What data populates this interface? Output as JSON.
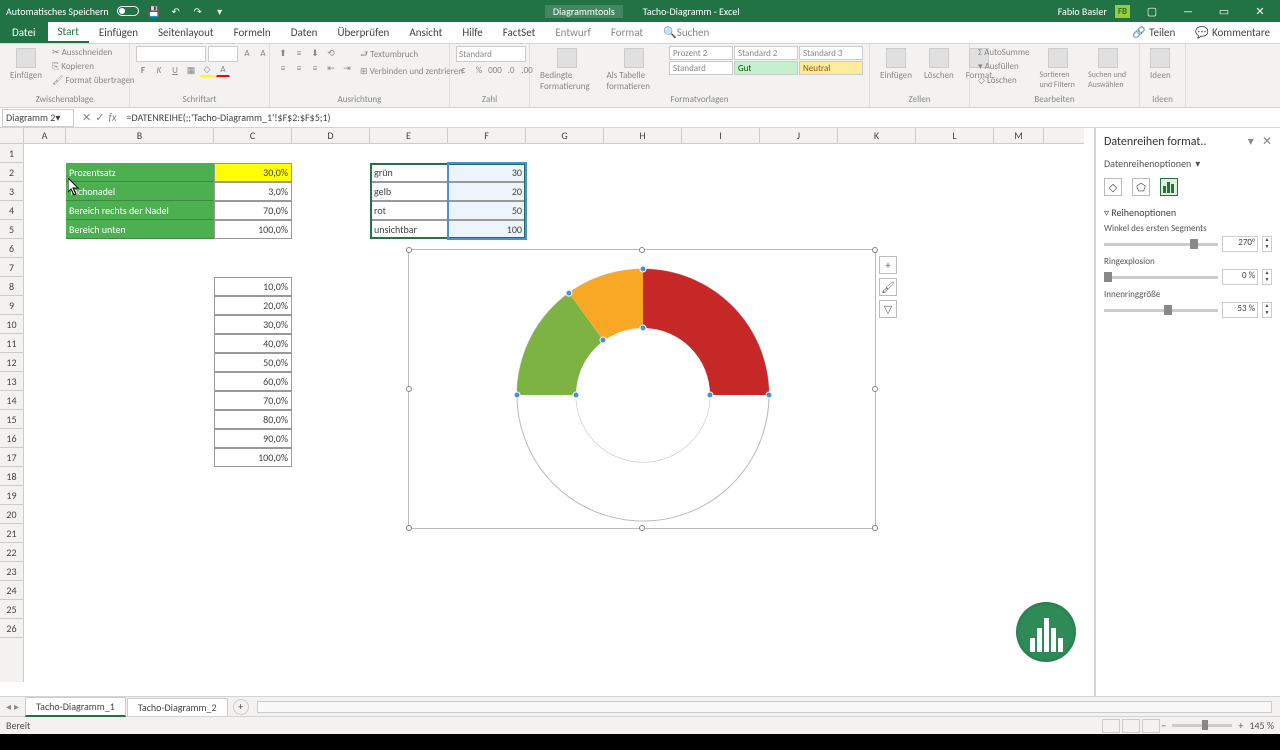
{
  "titlebar": {
    "autosave": "Automatisches Speichern",
    "tools": "Diagrammtools",
    "docname": "Tacho-Diagramm - Excel",
    "username": "Fabio Basler",
    "userinitials": "FB"
  },
  "tabs": {
    "file": "Datei",
    "start": "Start",
    "insert": "Einfügen",
    "layout": "Seitenlayout",
    "formulas": "Formeln",
    "data": "Daten",
    "review": "Überprüfen",
    "view": "Ansicht",
    "help": "Hilfe",
    "factset": "FactSet",
    "design": "Entwurf",
    "format": "Format",
    "search": "Suchen",
    "share": "Teilen",
    "comments": "Kommentare"
  },
  "ribbon": {
    "clipboard": {
      "label": "Zwischenablage",
      "paste": "Einfügen",
      "cut": "Ausschneiden",
      "copy": "Kopieren",
      "formatpainter": "Format übertragen"
    },
    "font": {
      "label": "Schriftart"
    },
    "align": {
      "label": "Ausrichtung",
      "wrap": "Textumbruch",
      "merge": "Verbinden und zentrieren"
    },
    "number": {
      "label": "Zahl",
      "std": "Standard"
    },
    "styles": {
      "label": "Formatvorlagen",
      "cond": "Bedingte Formatierung",
      "table": "Als Tabelle formatieren",
      "p1": "Prozent 2",
      "s2": "Standard 2",
      "s3": "Standard 3",
      "std": "Standard",
      "gut": "Gut",
      "neutral": "Neutral"
    },
    "cells": {
      "label": "Zellen",
      "ins": "Einfügen",
      "del": "Löschen",
      "fmt": "Format"
    },
    "editing": {
      "label": "Bearbeiten",
      "sum": "AutoSumme",
      "fill": "Ausfüllen",
      "clear": "Löschen",
      "sort": "Sortieren und Filtern",
      "find": "Suchen und Auswählen"
    },
    "ideas": {
      "label": "Ideen",
      "btn": "Ideen"
    }
  },
  "formula": {
    "namebox": "Diagramm 2",
    "formula": "=DATENREIHE(;;'Tacho-Diagramm_1'!$F$2:$F$5;1)"
  },
  "columns": [
    "A",
    "B",
    "C",
    "D",
    "E",
    "F",
    "G",
    "H",
    "I",
    "J",
    "K",
    "L",
    "M"
  ],
  "table1": {
    "r1": {
      "b": "Prozentsatz",
      "c": "30,0%"
    },
    "r2": {
      "b": "Tachonadel",
      "c": "3,0%"
    },
    "r3": {
      "b": "Bereich rechts der Nadel",
      "c": "70,0%"
    },
    "r4": {
      "b": "Bereich unten",
      "c": "100,0%"
    }
  },
  "table2": {
    "r1": {
      "e": "grün",
      "f": "30"
    },
    "r2": {
      "e": "gelb",
      "f": "20"
    },
    "r3": {
      "e": "rot",
      "f": "50"
    },
    "r4": {
      "e": "unsichtbar",
      "f": "100"
    }
  },
  "table3": {
    "r8": "10,0%",
    "r9": "20,0%",
    "r10": "30,0%",
    "r11": "40,0%",
    "r12": "50,0%",
    "r13": "60,0%",
    "r14": "70,0%",
    "r15": "80,0%",
    "r16": "90,0%",
    "r17": "100,0%"
  },
  "taskpane": {
    "title": "Datenreihen format..",
    "subtitle": "Datenreihenoptionen",
    "section": "Reihenoptionen",
    "angle": {
      "label": "Winkel des ersten Segments",
      "value": "270°"
    },
    "explosion": {
      "label": "Ringexplosion",
      "value": "0 %"
    },
    "inner": {
      "label": "Innenringgröße",
      "value": "53 %"
    }
  },
  "sheets": {
    "s1": "Tacho-Diagramm_1",
    "s2": "Tacho-Diagramm_2"
  },
  "status": {
    "ready": "Bereit",
    "zoom": "145 %"
  },
  "chart_data": {
    "type": "pie",
    "categories": [
      "grün",
      "gelb",
      "rot",
      "unsichtbar"
    ],
    "values": [
      30,
      20,
      50,
      100
    ],
    "colors": [
      "#7cb342",
      "#f9a825",
      "#c62828",
      "#ffffff"
    ],
    "first_slice_angle": 270,
    "donut_hole_pct": 53,
    "explosion_pct": 0
  },
  "colwidths": {
    "A": 42,
    "B": 148,
    "C": 78,
    "D": 78,
    "E": 78,
    "F": 78,
    "G": 78,
    "H": 78,
    "I": 78,
    "J": 78,
    "K": 78,
    "L": 78,
    "M": 50
  }
}
